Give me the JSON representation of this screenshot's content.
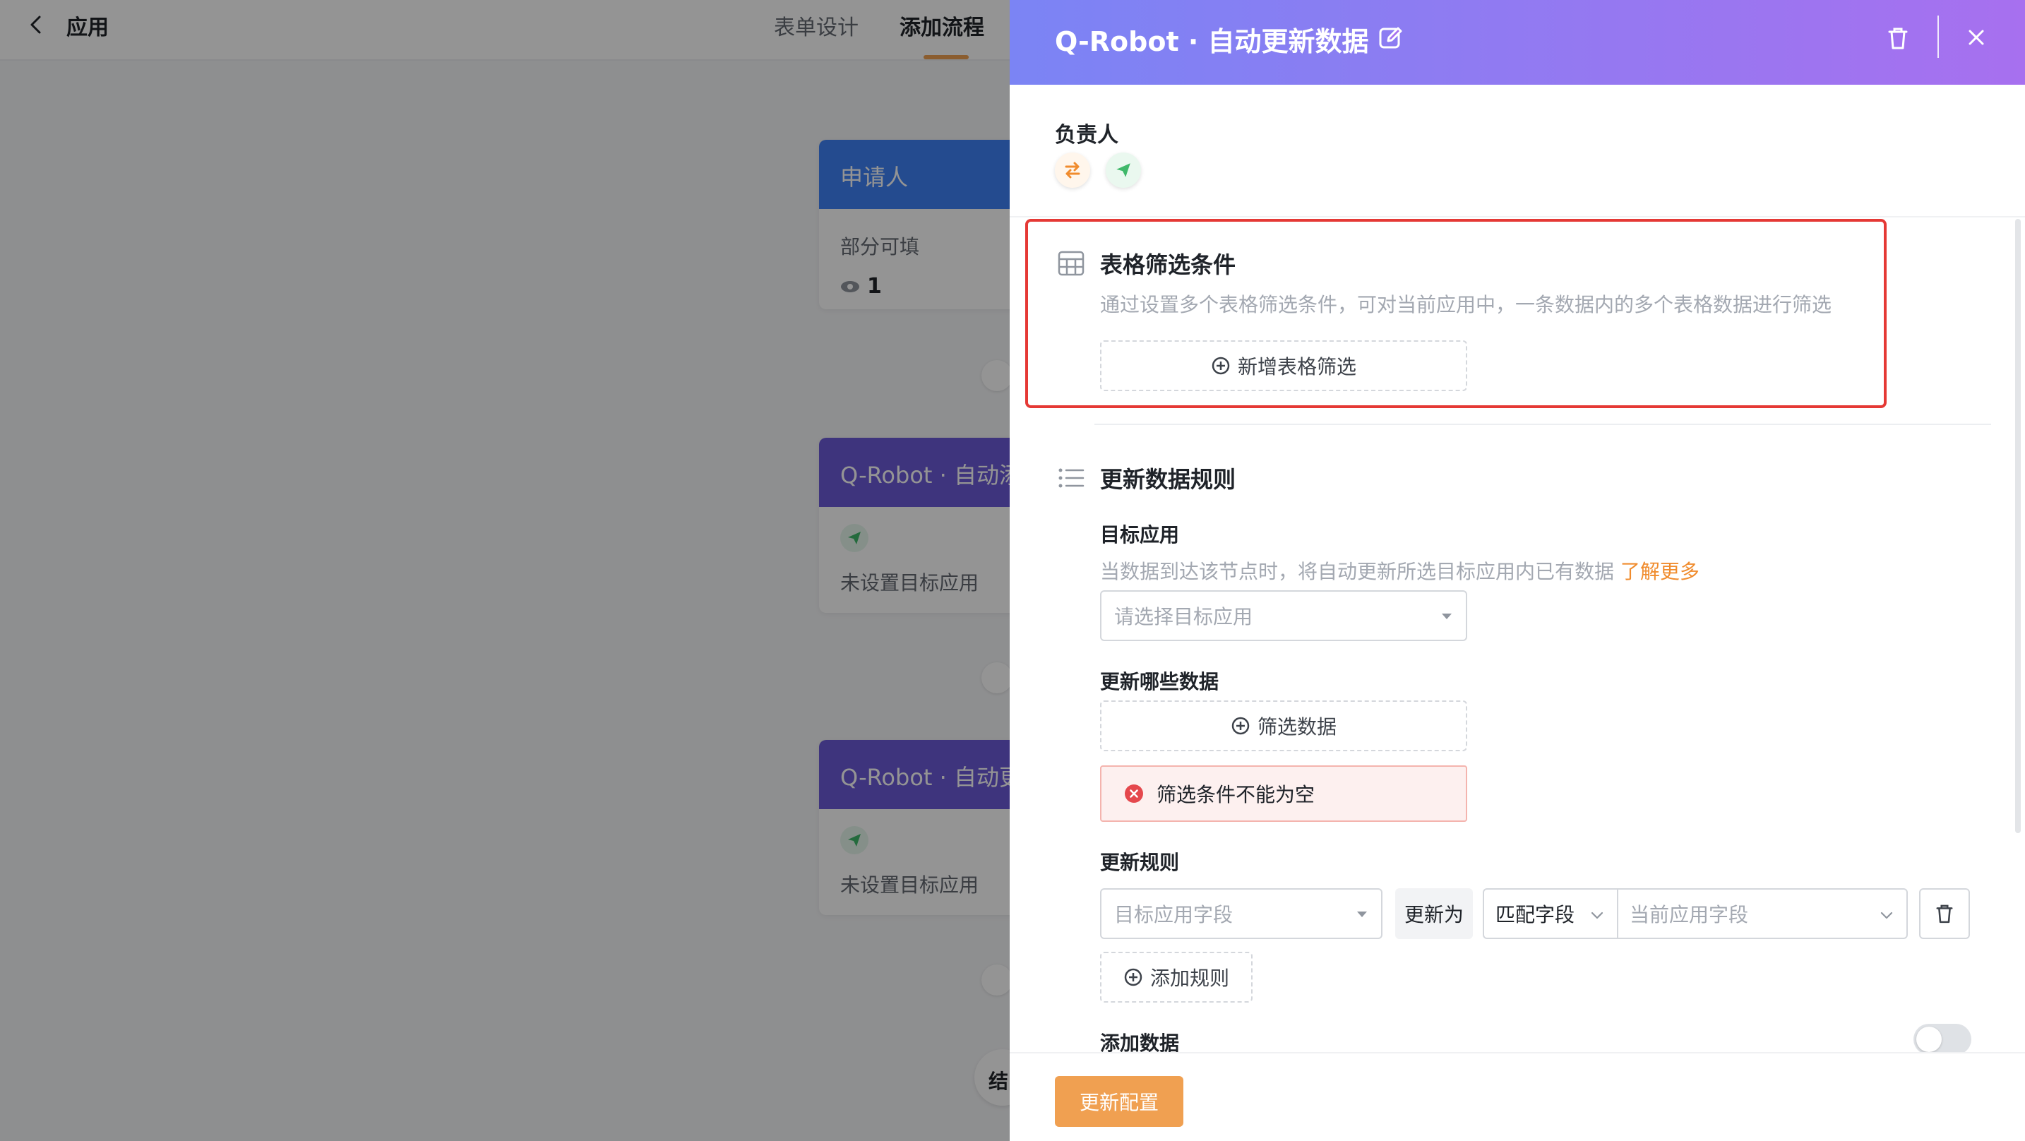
{
  "topbar": {
    "back_icon": "chevron-left-icon",
    "app_title": "应用",
    "tabs": [
      {
        "label": "表单设计",
        "active": false
      },
      {
        "label": "添加流程",
        "active": true
      }
    ]
  },
  "flow": {
    "nodes": [
      {
        "title": "申请人",
        "line1": "部分可填",
        "count": "1"
      },
      {
        "title": "Q-Robot · 自动添",
        "line1": "未设置目标应用"
      },
      {
        "title": "Q-Robot · 自动更",
        "line1": "未设置目标应用"
      }
    ],
    "end_label": "结"
  },
  "drawer": {
    "title": "Q-Robot · 自动更新数据",
    "owner_label": "负责人",
    "filter_section": {
      "title": "表格筛选条件",
      "description": "通过设置多个表格筛选条件，可对当前应用中，一条数据内的多个表格数据进行筛选",
      "add_button": "新增表格筛选"
    },
    "rule_section": {
      "title": "更新数据规则",
      "target_label": "目标应用",
      "target_desc": "当数据到达该节点时，将自动更新所选目标应用内已有数据",
      "learn_more": "了解更多",
      "target_placeholder": "请选择目标应用",
      "which_label": "更新哪些数据",
      "filter_button": "筛选数据",
      "error_text": "筛选条件不能为空",
      "update_rule_label": "更新规则",
      "target_field_placeholder": "目标应用字段",
      "update_to": "更新为",
      "match_field": "匹配字段",
      "current_field_placeholder": "当前应用字段",
      "add_rule_button": "添加规则",
      "add_data_label": "添加数据",
      "add_data_enabled": false
    },
    "footer_button": "更新配置"
  },
  "colors": {
    "accent": "#f0a051",
    "header_gradient_start": "#7b84f4",
    "header_gradient_end": "#a770ef",
    "error": "#e53935",
    "applicant_node": "#3f82f7",
    "robot_node": "#6c5bd8"
  }
}
